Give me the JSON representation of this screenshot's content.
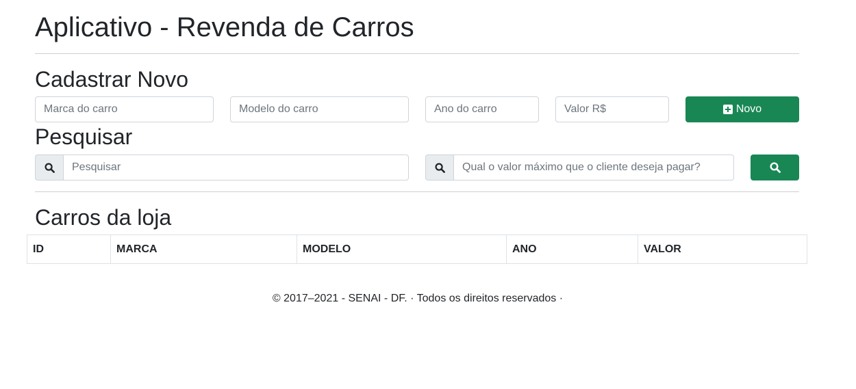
{
  "header": {
    "title": "Aplicativo - Revenda de Carros"
  },
  "register": {
    "heading": "Cadastrar Novo",
    "brand_placeholder": "Marca do carro",
    "model_placeholder": "Modelo do carro",
    "year_placeholder": "Ano do carro",
    "price_placeholder": "Valor R$",
    "new_button_label": "Novo",
    "new_button_icon": "plus-square-icon"
  },
  "search": {
    "heading": "Pesquisar",
    "search_placeholder": "Pesquisar",
    "max_value_placeholder": "Qual o valor máximo que o cliente deseja pagar?",
    "addon_icon": "search-icon",
    "button_icon": "search-icon"
  },
  "cars": {
    "heading": "Carros da loja",
    "columns": [
      "ID",
      "MARCA",
      "MODELO",
      "ANO",
      "VALOR"
    ],
    "rows": []
  },
  "footer": {
    "text": "© 2017–2021 - SENAI - DF. · Todos os direitos reservados ·"
  },
  "colors": {
    "primary_green": "#198754",
    "text": "#212529",
    "placeholder": "#6c757d",
    "border": "#ced4da",
    "addon_bg": "#e9ecef"
  }
}
